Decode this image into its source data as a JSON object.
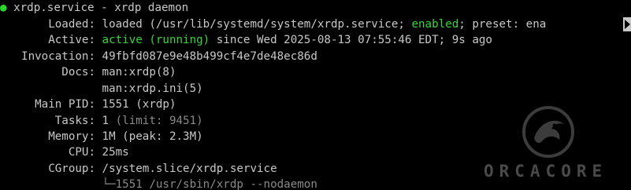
{
  "service_header": {
    "dot": "●",
    "text": "xrdp.service - xrdp daemon"
  },
  "loaded": {
    "key": "Loaded:",
    "prefix": "loaded (/usr/lib/systemd/system/xrdp.service; ",
    "enabled": "enabled",
    "suffix": "; preset: ena"
  },
  "active": {
    "key": "Active:",
    "status": "active (running)",
    "since": " since Wed 2025-08-13 07:55:46 EDT; 9s ago"
  },
  "invocation": {
    "key": "Invocation:",
    "value": "49fbfd087e9e48b499cf4e7de48ec86d"
  },
  "docs": {
    "key": "Docs:",
    "values": [
      "man:xrdp(8)",
      "man:xrdp.ini(5)"
    ]
  },
  "main_pid": {
    "key": "Main PID:",
    "value": "1551 (xrdp)"
  },
  "tasks": {
    "key": "Tasks:",
    "value": "1 ",
    "limit": "(limit: 9451)"
  },
  "memory": {
    "key": "Memory:",
    "value": "1M (peak: 2.3M)"
  },
  "cpu": {
    "key": "CPU:",
    "value": "25ms"
  },
  "cgroup": {
    "key": "CGroup:",
    "value": "/system.slice/xrdp.service",
    "tree_prefix": "└─",
    "process": "1551 /usr/sbin/xrdp --nodaemon"
  },
  "watermark": {
    "text": "ORCACORE",
    "icon": "orca-logo-icon"
  },
  "colors": {
    "background": "#000000",
    "text": "#c8c8c8",
    "green": "#39d439",
    "dim": "#8a8a8a"
  }
}
